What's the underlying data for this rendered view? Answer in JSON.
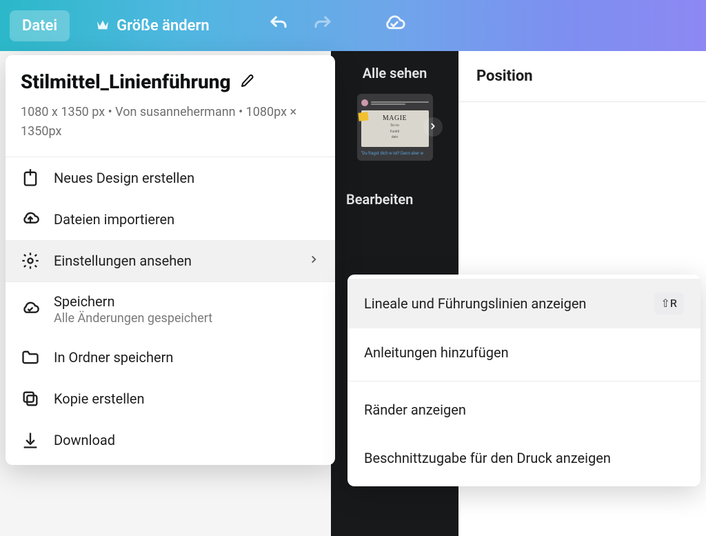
{
  "topbar": {
    "file_label": "Datei",
    "resize_label": "Größe ändern"
  },
  "position_panel": {
    "title": "Position"
  },
  "dark_col": {
    "see_all": "Alle sehen",
    "thumb_title": "MAGIE",
    "thumb_sub1": "So nu",
    "thumb_sub2": "Funkti",
    "thumb_sub3": "dein",
    "thumb_caption": "\"Du fragst dich w\nist? Dann aber w\n",
    "edit": "Bearbeiten"
  },
  "file_panel": {
    "title": "Stilmittel_Linienführung",
    "meta": "1080 x 1350 px • Von susannehermann • 1080px × 1350px",
    "items": {
      "new": "Neues Design erstellen",
      "import": "Dateien importieren",
      "settings": "Einstellungen ansehen",
      "save": "Speichern",
      "save_sub": "Alle Änderungen gespeichert",
      "folder": "In Ordner speichern",
      "copy": "Kopie erstellen",
      "download": "Download"
    }
  },
  "submenu": {
    "rulers": "Lineale und Führungslinien anzeigen",
    "rulers_shortcut": "⇧R",
    "add_guides": "Anleitungen hinzufügen",
    "margins": "Ränder anzeigen",
    "bleed": "Beschnittzugabe für den Druck anzeigen"
  }
}
